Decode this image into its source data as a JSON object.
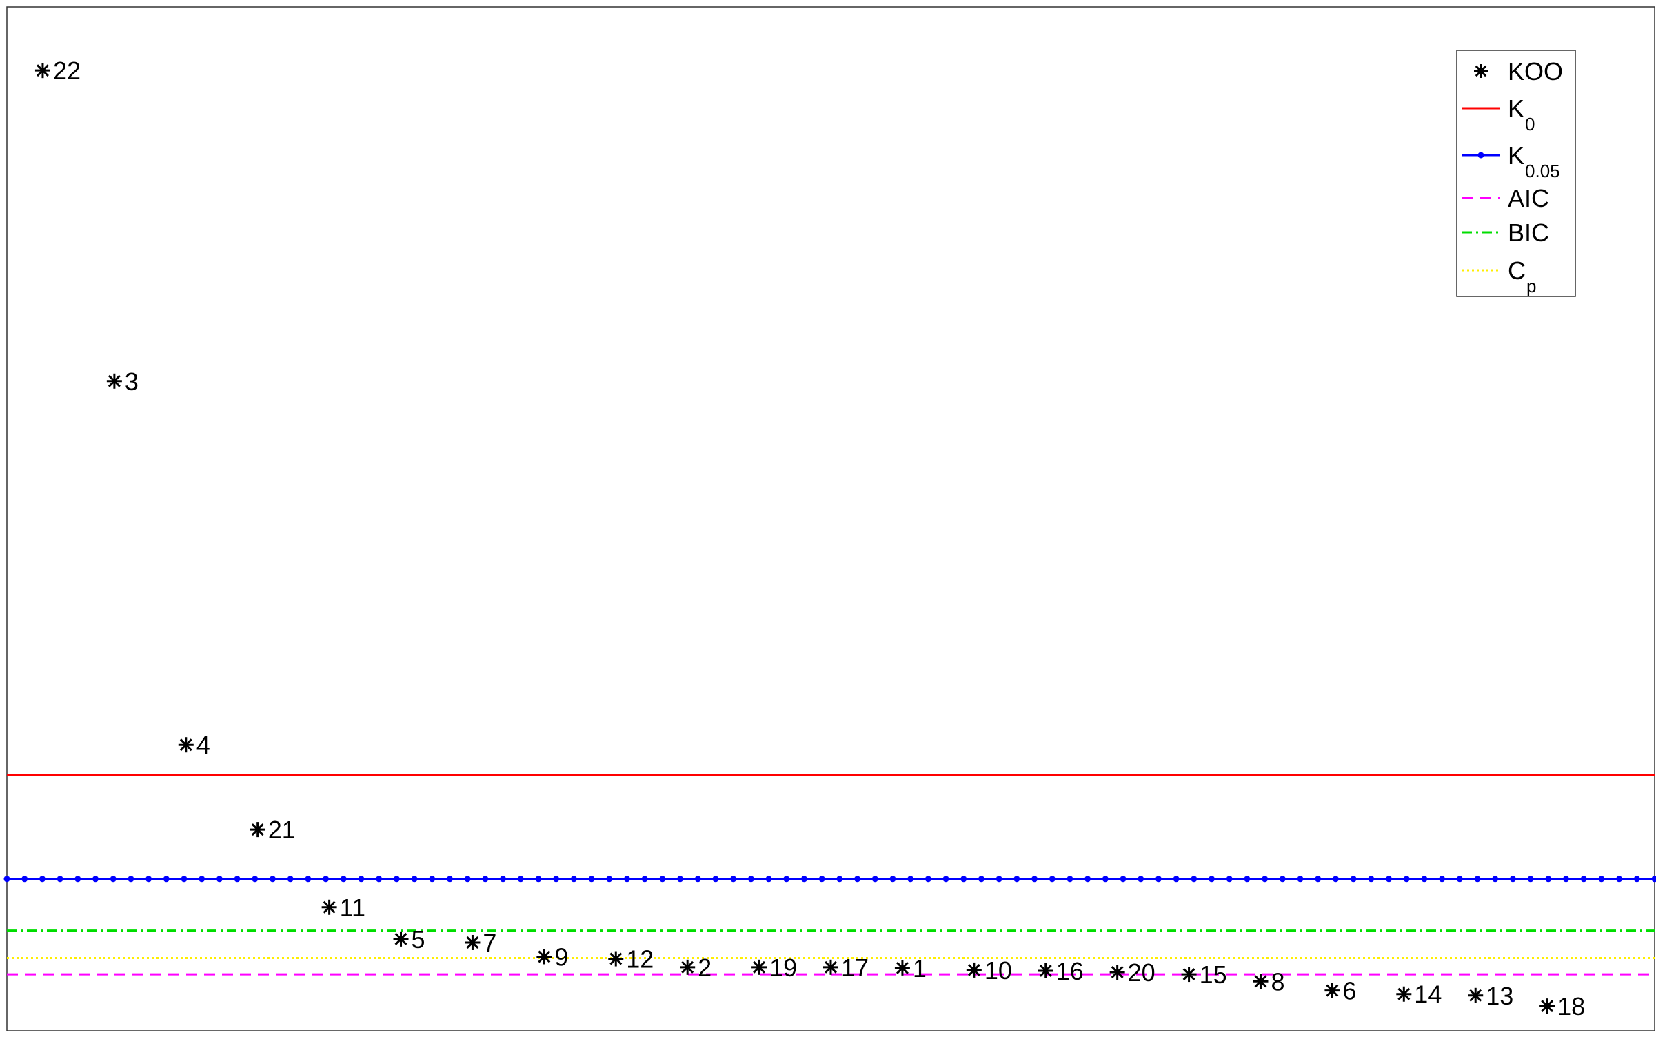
{
  "chart_data": {
    "type": "scatter",
    "title": "",
    "xlabel": "",
    "ylabel": "",
    "xlim": [
      0.5,
      23.5
    ],
    "ylim": [
      -0.3,
      14.2
    ],
    "grid": false,
    "axis_ticks_visible": false,
    "legend_position": "top-right",
    "points": [
      {
        "label": "22",
        "x": 1,
        "y": 13.3
      },
      {
        "label": "3",
        "x": 2,
        "y": 8.9
      },
      {
        "label": "4",
        "x": 3,
        "y": 3.75
      },
      {
        "label": "21",
        "x": 4,
        "y": 2.55
      },
      {
        "label": "11",
        "x": 5,
        "y": 1.45
      },
      {
        "label": "5",
        "x": 6,
        "y": 1.0
      },
      {
        "label": "7",
        "x": 7,
        "y": 0.95
      },
      {
        "label": "9",
        "x": 8,
        "y": 0.75
      },
      {
        "label": "12",
        "x": 9,
        "y": 0.72
      },
      {
        "label": "2",
        "x": 10,
        "y": 0.6
      },
      {
        "label": "19",
        "x": 11,
        "y": 0.6
      },
      {
        "label": "17",
        "x": 12,
        "y": 0.6
      },
      {
        "label": "1",
        "x": 13,
        "y": 0.59
      },
      {
        "label": "10",
        "x": 14,
        "y": 0.56
      },
      {
        "label": "16",
        "x": 15,
        "y": 0.55
      },
      {
        "label": "20",
        "x": 16,
        "y": 0.53
      },
      {
        "label": "15",
        "x": 17,
        "y": 0.5
      },
      {
        "label": "8",
        "x": 18,
        "y": 0.4
      },
      {
        "label": "6",
        "x": 19,
        "y": 0.27
      },
      {
        "label": "14",
        "x": 20,
        "y": 0.22
      },
      {
        "label": "13",
        "x": 21,
        "y": 0.2
      },
      {
        "label": "18",
        "x": 22,
        "y": 0.05
      }
    ],
    "thresholds": [
      {
        "key": "K0",
        "name": "K",
        "sub": "0",
        "y": 3.32,
        "color": "#ff0000",
        "style": "solid"
      },
      {
        "key": "K005",
        "name": "K",
        "sub": "0.05",
        "y": 1.85,
        "color": "#0000ff",
        "style": "solid-dots"
      },
      {
        "key": "AIC",
        "name": "AIC",
        "sub": "",
        "y": 0.5,
        "color": "#ff00ff",
        "style": "dashed"
      },
      {
        "key": "BIC",
        "name": "BIC",
        "sub": "",
        "y": 1.12,
        "color": "#00dd00",
        "style": "dashdot"
      },
      {
        "key": "Cp",
        "name": "C",
        "sub": "p",
        "y": 0.73,
        "color": "#ffee00",
        "style": "dotted"
      }
    ],
    "legend": [
      {
        "key": "KOO",
        "name": "KOO",
        "sub": ""
      },
      {
        "key": "K0",
        "name": "K",
        "sub": "0"
      },
      {
        "key": "K005",
        "name": "K",
        "sub": "0.05"
      },
      {
        "key": "AIC",
        "name": "AIC",
        "sub": ""
      },
      {
        "key": "BIC",
        "name": "BIC",
        "sub": ""
      },
      {
        "key": "Cp",
        "name": "C",
        "sub": "p"
      }
    ]
  }
}
